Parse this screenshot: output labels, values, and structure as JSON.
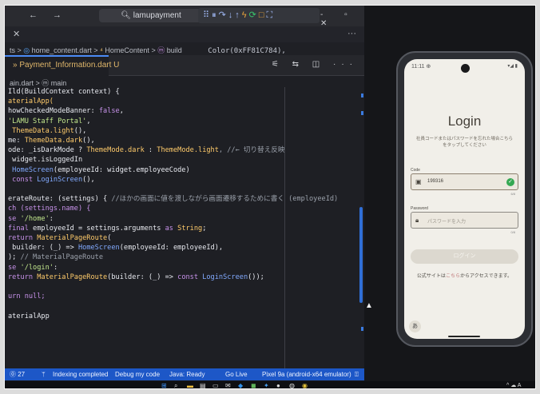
{
  "ide": {
    "nav_arrows": "← →",
    "search": "lamupayment",
    "window_controls": "- ▫ ✕",
    "tab_close": "✕",
    "breadcrumb1": {
      "prefix": "ts >",
      "file": "home_content.dart",
      "sep": ">",
      "class": "HomeContent",
      "sep2": ">",
      "method": "build"
    },
    "partial_line": "Color(0xFF81C784),",
    "active_tab": "Payment_Information.dart U",
    "tab_actions": "⚟ ⇆ ◫ ···",
    "breadcrumb2": "ain.dart > ⓜ main",
    "code_lines": [
      [
        [
          "Ild(BuildContext context) {",
          "vr"
        ]
      ],
      [
        [
          "aterialApp(",
          "ty"
        ]
      ],
      [
        [
          "howCheckedModeBanner: ",
          "vr"
        ],
        [
          "false",
          "kw"
        ],
        [
          ",",
          "vr"
        ]
      ],
      [
        [
          "'LAMU Staff Portal'",
          "str"
        ],
        [
          ",",
          "vr"
        ]
      ],
      [
        [
          " ThemeData.light",
          "ty"
        ],
        [
          "(),",
          "vr"
        ]
      ],
      [
        [
          "me: ",
          "vr"
        ],
        [
          "ThemeData.dark",
          "ty"
        ],
        [
          "(),",
          "vr"
        ]
      ],
      [
        [
          "ode: ",
          "vr"
        ],
        [
          "_isDarkMode ? ",
          "vr"
        ],
        [
          "ThemeMode.dark",
          "ty"
        ],
        [
          " : ",
          "vr"
        ],
        [
          "ThemeMode.light",
          "ty"
        ],
        [
          ", //← 切り替え反映",
          "cm"
        ]
      ],
      [
        [
          " widget.isLoggedIn",
          "vr"
        ]
      ],
      [
        [
          " HomeScreen",
          "fn"
        ],
        [
          "(employeeId: widget.employeeCode)",
          "vr"
        ]
      ],
      [
        [
          " const ",
          "kw"
        ],
        [
          "LoginScreen",
          "fn"
        ],
        [
          "(),",
          "vr"
        ]
      ],
      [
        [
          "",
          ""
        ]
      ],
      [
        [
          "erateRoute: (settings) { ",
          "vr"
        ],
        [
          "//ほかの画面に値を渡しながら画面遷移するために書く (employeeId)",
          "cm"
        ]
      ],
      [
        [
          "ch (settings.name) {",
          "kw"
        ]
      ],
      [
        [
          "se ",
          "kw"
        ],
        [
          "'/home'",
          "str"
        ],
        [
          ":",
          "vr"
        ]
      ],
      [
        [
          "final ",
          "kw"
        ],
        [
          "employeeId = settings.arguments ",
          "vr"
        ],
        [
          "as ",
          "kw"
        ],
        [
          "String",
          "ty"
        ],
        [
          ";",
          "vr"
        ]
      ],
      [
        [
          "return ",
          "kw"
        ],
        [
          "MaterialPageRoute",
          "ty"
        ],
        [
          "(",
          "vr"
        ]
      ],
      [
        [
          " builder: (_) => ",
          "vr"
        ],
        [
          "HomeScreen",
          "fn"
        ],
        [
          "(employeeId: employeeId),",
          "vr"
        ]
      ],
      [
        [
          "); ",
          "vr"
        ],
        [
          "// MaterialPageRoute",
          "cm"
        ]
      ],
      [
        [
          "se ",
          "kw"
        ],
        [
          "'/login'",
          "str"
        ],
        [
          ":",
          "vr"
        ]
      ],
      [
        [
          "return ",
          "kw"
        ],
        [
          "MaterialPageRoute",
          "ty"
        ],
        [
          "(builder: (_) => ",
          "vr"
        ],
        [
          "const ",
          "kw"
        ],
        [
          "LoginScreen",
          "fn"
        ],
        [
          "());",
          "vr"
        ]
      ],
      [
        [
          "",
          ""
        ]
      ],
      [
        [
          "urn null;",
          "kw"
        ]
      ],
      [
        [
          "",
          ""
        ]
      ],
      [
        [
          "aterialApp",
          "vr"
        ]
      ]
    ],
    "status": {
      "errors": "⓪ 27",
      "branch": "ᛘ",
      "indexing": "Indexing completed",
      "debug": "Debug my code",
      "java": "Java: Ready",
      "golive": "Go Live",
      "device": "Pixel 9a (android-x64 emulator)",
      "bell": "⍐"
    }
  },
  "phone": {
    "clock": "11:11 ⊕",
    "signal": "▾◢ ▮",
    "title": "Login",
    "hint": "社員コードまたはパスワードを忘れた場合こちらをタップしてください",
    "code_label": "Code",
    "code_value": "199316",
    "code_counter": "6/8",
    "password_label": "Password",
    "password_placeholder": "パスワードを入力",
    "password_counter": "0/8",
    "login_button": "ログイン",
    "site_text_1": "公式サイトは",
    "site_link": "こちら",
    "site_text_2": "からアクセスできます。",
    "round_button": "あ"
  },
  "taskbar": {
    "tray": "^ ☁ A"
  }
}
